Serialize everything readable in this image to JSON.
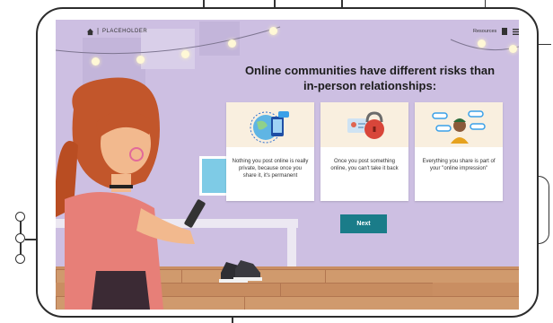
{
  "breadcrumb": {
    "label": "PLACEHOLDER"
  },
  "header": {
    "resources_label": "Resources"
  },
  "main": {
    "heading": "Online communities have different risks than in-person relationships:",
    "cards": [
      {
        "text": "Nothing you post online is really private, because once you share it, it's permanent",
        "icon": "globe-phone-icon"
      },
      {
        "text": "Once you post something online, you can't take it back",
        "icon": "lock-profile-icon"
      },
      {
        "text": "Everything you share is part of your \"online impression\"",
        "icon": "person-chat-icon"
      }
    ],
    "next_label": "Next"
  },
  "colors": {
    "accent": "#1a7c89",
    "background": "#d4c9e6",
    "card_band": "#f9efdf"
  }
}
